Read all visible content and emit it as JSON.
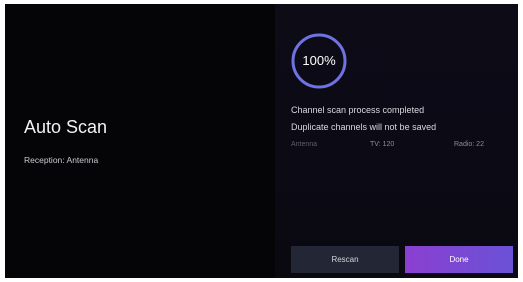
{
  "left": {
    "title": "Auto Scan",
    "reception": "Reception: Antenna"
  },
  "progress": {
    "value": 100,
    "label": "100%",
    "ring_color": "#6f72e0"
  },
  "messages": {
    "line1": "Channel scan process completed",
    "line2": "Duplicate channels will not be saved"
  },
  "stats": {
    "source": "Antenna",
    "tv": "TV: 120",
    "radio": "Radio: 22"
  },
  "buttons": {
    "rescan": "Rescan",
    "done": "Done"
  },
  "colors": {
    "background": "#050508",
    "accent_gradient_start": "#8b3fd0",
    "accent_gradient_end": "#6a52d6"
  }
}
